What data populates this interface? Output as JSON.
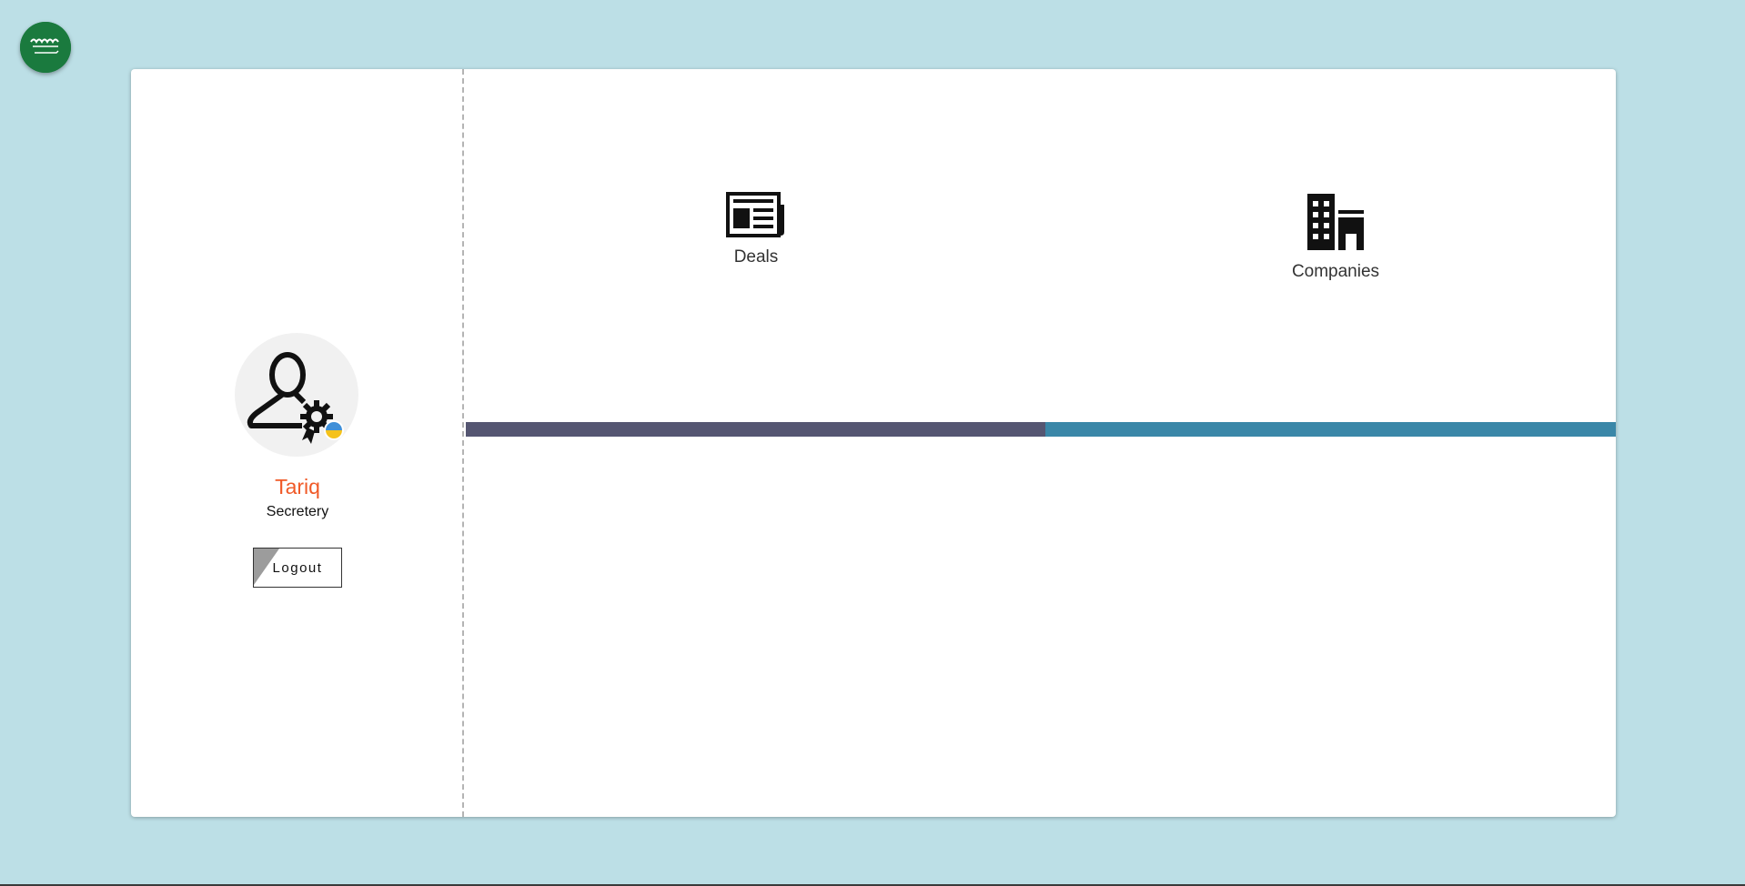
{
  "country_flag": {
    "name": "saudi-arabia-flag",
    "color": "#1a7a3e"
  },
  "user": {
    "name": "Tariq",
    "role": "Secretery",
    "avatar_icon": "user-settings-icon",
    "status_colors": [
      "#3f8fd8",
      "#f5c21b"
    ]
  },
  "actions": {
    "logout_label": "Logout"
  },
  "nav": {
    "deals": {
      "label": "Deals",
      "icon": "newspaper-icon"
    },
    "companies": {
      "label": "Companies",
      "icon": "buildings-icon"
    }
  },
  "progress": {
    "fraction": 0.504,
    "fill_color": "#555672",
    "track_color": "#3a87a8"
  },
  "colors": {
    "background": "#bcdfe6",
    "name_accent": "#f05a28",
    "card": "#ffffff"
  }
}
